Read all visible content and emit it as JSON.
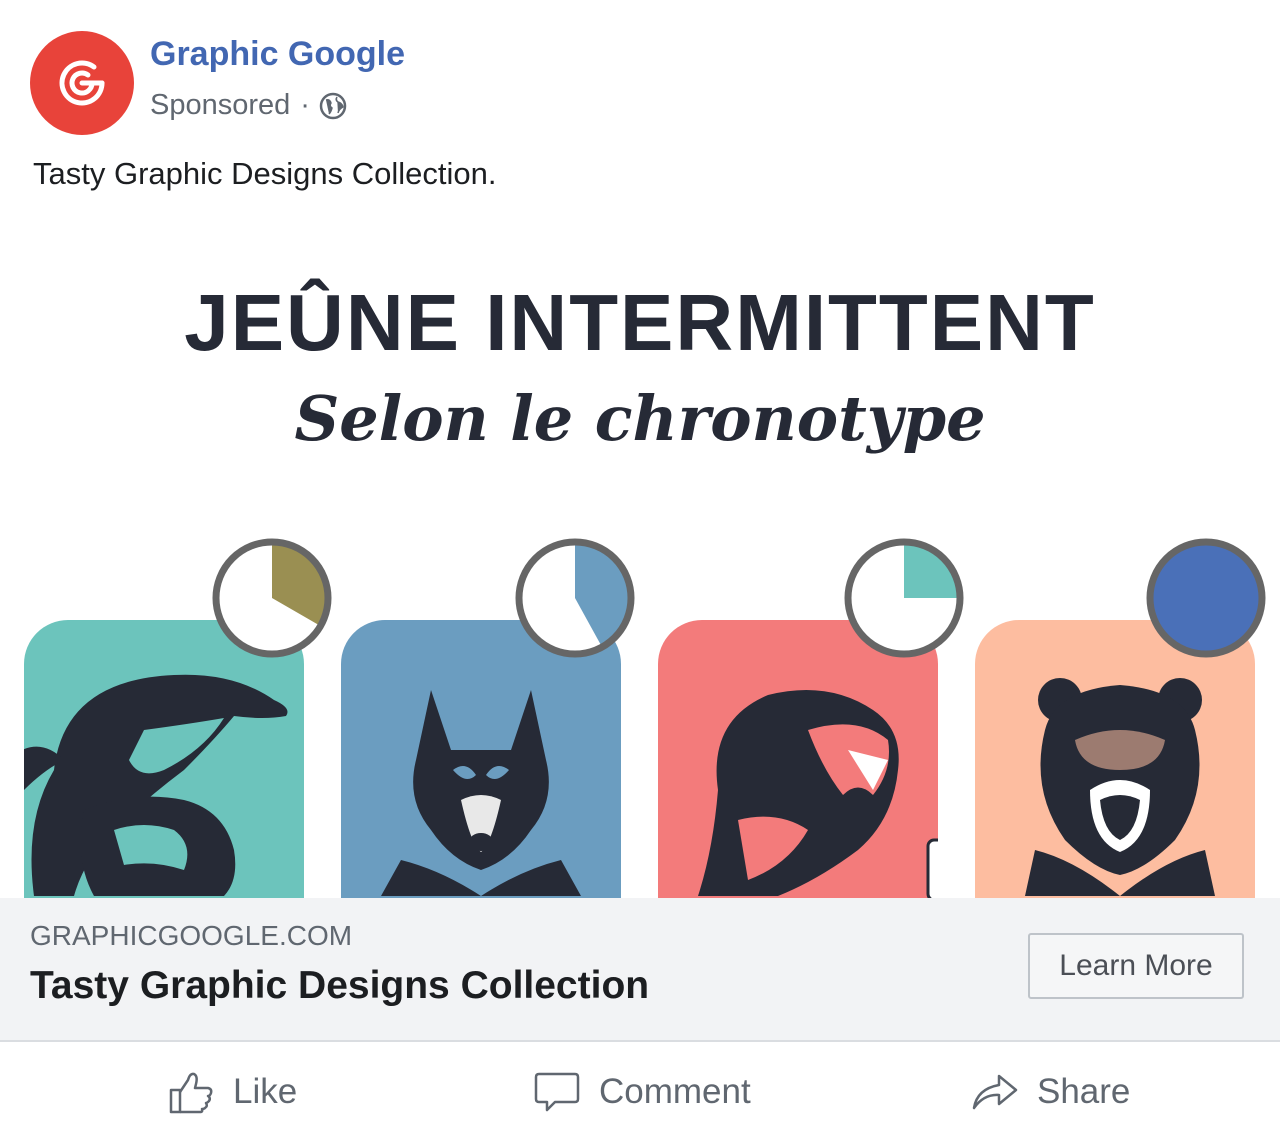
{
  "post": {
    "page_name": "Graphic Google",
    "sponsored_label": "Sponsored",
    "separator": "·",
    "text": "Tasty Graphic Designs Collection."
  },
  "creative": {
    "headline": "JEÛNE INTERMITTENT",
    "subheadline": "Selon le chronotype",
    "cards": [
      {
        "animal": "dolphin",
        "color": "#6cc4bc",
        "clock_color": "#9a8f52",
        "clock_fill": 0.33
      },
      {
        "animal": "wolf",
        "color": "#6b9dc0",
        "clock_color": "#6b9dc0",
        "clock_fill": 0.42
      },
      {
        "animal": "lion",
        "color": "#f37b7b",
        "clock_color": "#6cc4bc",
        "clock_fill": 0.25
      },
      {
        "animal": "bear",
        "color": "#fdbda0",
        "clock_color": "#4a70b8",
        "clock_fill": 1.0
      }
    ]
  },
  "link": {
    "domain": "GRAPHICGOOGLE.COM",
    "title": "Tasty Graphic Designs Collection",
    "cta_label": "Learn More"
  },
  "actions": {
    "like": "Like",
    "comment": "Comment",
    "share": "Share"
  },
  "colors": {
    "brand_blue": "#4267b2",
    "avatar_red": "#e8433a",
    "link_bar_bg": "#f2f3f5"
  }
}
